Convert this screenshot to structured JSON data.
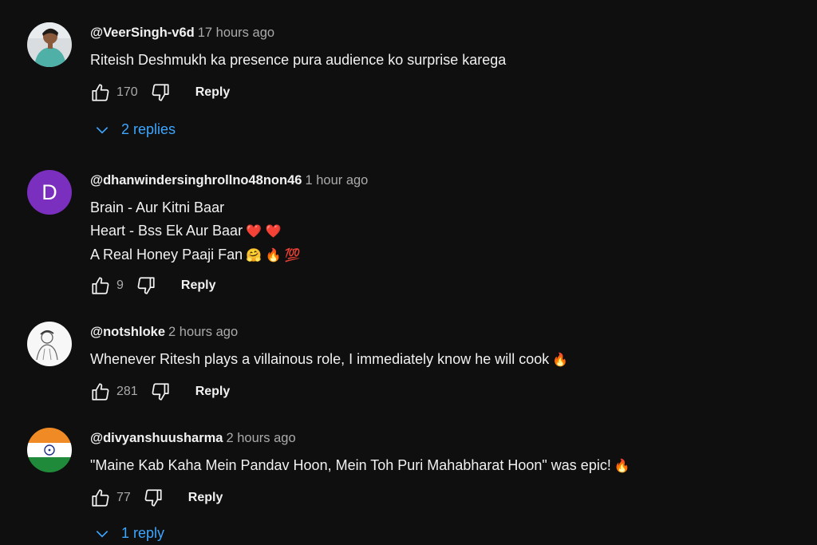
{
  "comments": [
    {
      "author": "@VeerSingh-v6d",
      "time": "17 hours ago",
      "lines": [
        "Riteish Deshmukh ka presence pura audience ko surprise karega"
      ],
      "likes": "170",
      "reply_label": "Reply",
      "replies_label": "2 replies",
      "avatar_icon": "photo-avatar"
    },
    {
      "author": "@dhanwindersinghrollno48non46",
      "time": "1 hour ago",
      "lines": [
        "Brain - Aur Kitni Baar",
        "Heart - Bss Ek Aur Baar",
        "A Real Honey Paaji Fan"
      ],
      "line_emojis": [
        "",
        "❤️ ❤️",
        "🤗 🔥 💯"
      ],
      "likes": "9",
      "reply_label": "Reply",
      "avatar_letter": "D",
      "avatar_color": "#7b2fbe"
    },
    {
      "author": "@notshloke",
      "time": "2 hours ago",
      "lines": [
        "Whenever Ritesh plays a villainous role, I immediately know he will cook"
      ],
      "line_emojis": [
        "🔥"
      ],
      "likes": "281",
      "reply_label": "Reply",
      "avatar_icon": "sketch-avatar"
    },
    {
      "author": "@divyanshuusharma",
      "time": "2 hours ago",
      "lines": [
        "\"Maine Kab Kaha Mein Pandav Hoon, Mein Toh Puri Mahabharat Hoon\" was epic!"
      ],
      "line_emojis": [
        "🔥"
      ],
      "likes": "77",
      "reply_label": "Reply",
      "replies_label": "1 reply",
      "avatar_icon": "india-flag-avatar"
    }
  ],
  "colors": {
    "background": "#0f0f0f",
    "text": "#f1f1f1",
    "secondary_text": "#aaaaaa",
    "link": "#3ea6ff"
  }
}
